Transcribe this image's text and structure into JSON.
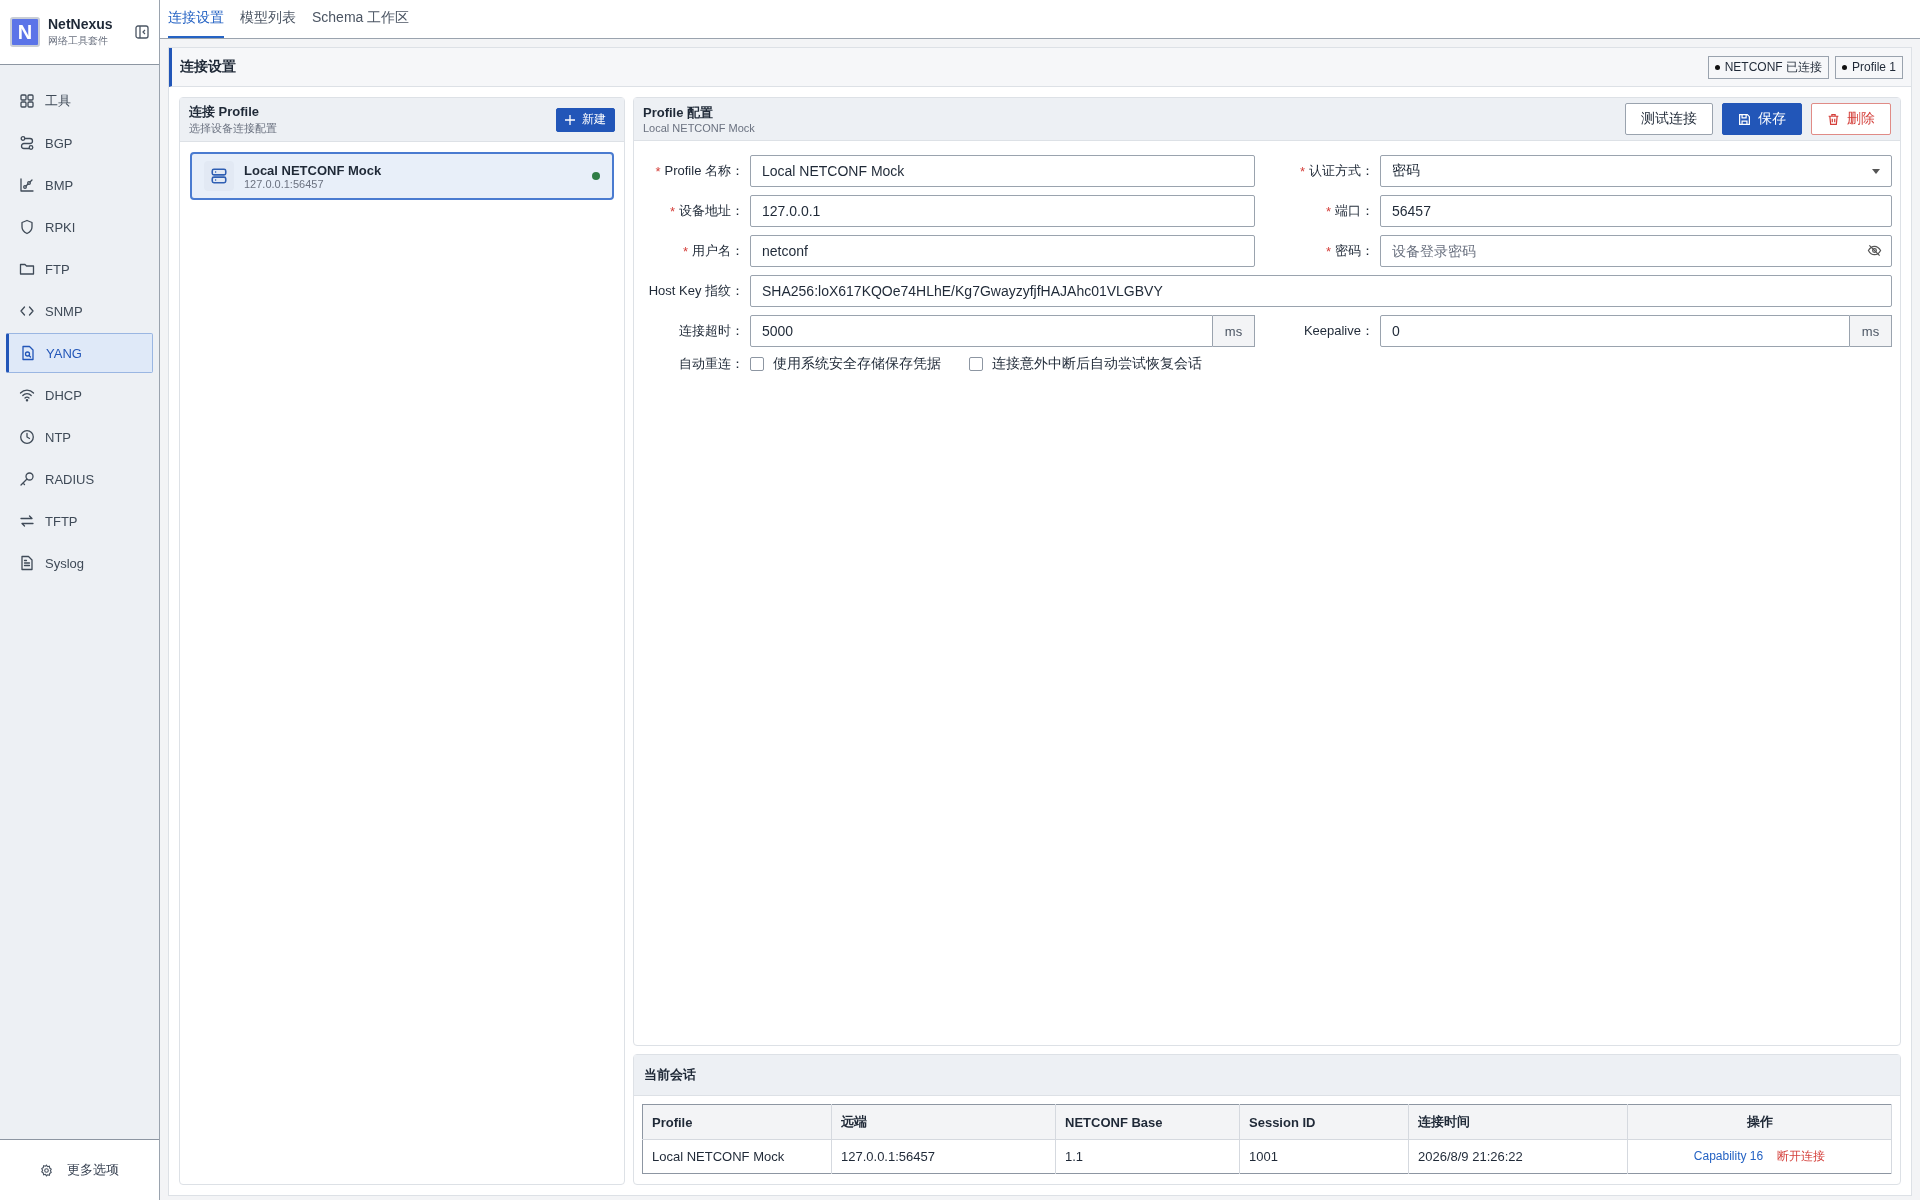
{
  "brand": {
    "name": "NetNexus",
    "subtitle": "网络工具套件",
    "logo_letter": "N"
  },
  "sidebar": {
    "items": [
      {
        "label": "工具",
        "selected": false
      },
      {
        "label": "BGP",
        "selected": false
      },
      {
        "label": "BMP",
        "selected": false
      },
      {
        "label": "RPKI",
        "selected": false
      },
      {
        "label": "FTP",
        "selected": false
      },
      {
        "label": "SNMP",
        "selected": false
      },
      {
        "label": "YANG",
        "selected": true
      },
      {
        "label": "DHCP",
        "selected": false
      },
      {
        "label": "NTP",
        "selected": false
      },
      {
        "label": "RADIUS",
        "selected": false
      },
      {
        "label": "TFTP",
        "selected": false
      },
      {
        "label": "Syslog",
        "selected": false
      }
    ],
    "footer": "更多选项"
  },
  "tabs": [
    {
      "label": "连接设置",
      "selected": true
    },
    {
      "label": "模型列表",
      "selected": false
    },
    {
      "label": "Schema 工作区",
      "selected": false
    }
  ],
  "section": {
    "title": "连接设置",
    "badges": [
      "NETCONF 已连接",
      "Profile 1"
    ]
  },
  "profiles": {
    "title": "连接 Profile",
    "subtitle": "选择设备连接配置",
    "new_button": "新建",
    "items": [
      {
        "name": "Local NETCONF Mock",
        "address": "127.0.0.1:56457",
        "selected": true,
        "online": true
      }
    ]
  },
  "config": {
    "required_mark": "*",
    "title": "Profile 配置",
    "subtitle": "Local NETCONF Mock",
    "buttons": [
      {
        "label": "测试连接",
        "kind": "plain"
      },
      {
        "label": "保存",
        "kind": "primary"
      },
      {
        "label": "删除",
        "kind": "danger"
      }
    ],
    "rows": [
      [
        {
          "label": "Profile 名称：",
          "required": true,
          "kind": "text",
          "value": "Local NETCONF Mock"
        },
        {
          "label": "认证方式：",
          "required": true,
          "kind": "select",
          "value": "密码"
        }
      ],
      [
        {
          "label": "设备地址：",
          "required": true,
          "kind": "text",
          "value": "127.0.0.1"
        },
        {
          "label": "端口：",
          "required": true,
          "kind": "text",
          "value": "56457"
        }
      ],
      [
        {
          "label": "用户名：",
          "required": true,
          "kind": "text",
          "value": "netconf"
        },
        {
          "label": "密码：",
          "required": true,
          "kind": "password",
          "placeholder": "设备登录密码"
        }
      ],
      [
        {
          "label": "Host Key 指纹：",
          "required": false,
          "kind": "wide",
          "value": "SHA256:loX617KQOe74HLhE/Kg7GwayzyfjfHAJAhc01VLGBVY"
        }
      ],
      [
        {
          "label": "连接超时：",
          "required": false,
          "kind": "unit",
          "value": "5000",
          "unit": "ms"
        },
        {
          "label": "Keepalive：",
          "required": false,
          "kind": "unit",
          "value": "0",
          "unit": "ms"
        }
      ]
    ],
    "reconnect": {
      "label": "自动重连：",
      "options": [
        {
          "label": "使用系统安全存储保存凭据",
          "checked": false
        },
        {
          "label": "连接意外中断后自动尝试恢复会话",
          "checked": false
        }
      ]
    }
  },
  "session": {
    "title": "当前会话",
    "columns": [
      "Profile",
      "远端",
      "NETCONF Base",
      "Session ID",
      "连接时间",
      "操作"
    ],
    "rows": [
      {
        "cells": [
          "Local NETCONF Mock",
          "127.0.0.1:56457",
          "1.1",
          "1001",
          "2026/8/9 21:26:22"
        ],
        "capability": "Capability 16",
        "disconnect": "断开连接"
      }
    ]
  }
}
